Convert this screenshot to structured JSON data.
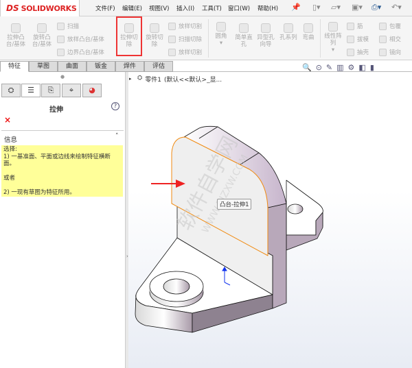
{
  "app": {
    "logo": "SOLIDWORKS",
    "logo_mark": "DS"
  },
  "menu": [
    "文件(F)",
    "编辑(E)",
    "视图(V)",
    "插入(I)",
    "工具(T)",
    "窗口(W)",
    "帮助(H)"
  ],
  "quick_access_icons": [
    "pin-icon",
    "new-icon",
    "open-icon",
    "save-icon",
    "print-icon",
    "undo-icon"
  ],
  "ribbon": {
    "extrude_boss": "拉伸凸\n台/基体",
    "revolve_boss": "旋转凸\n台/基体",
    "sweep": "扫描",
    "loft_boss": "放样凸台/基体",
    "boundary_boss": "边界凸台/基体",
    "extrude_cut": "拉伸切\n除",
    "revolve_cut": "旋转切\n除",
    "loft_cut": "放样切割",
    "sweep_cut": "扫描切除",
    "boundary_cut": "放样切割",
    "fillet": "圆角",
    "simple_hole": "简单直\n孔",
    "hole_wizard": "异型孔\n向导",
    "hole_series": "孔系列",
    "flex": "弯曲",
    "linear_pattern": "线性阵\n列",
    "rib": "筋",
    "draft": "拔模",
    "shell": "抽壳",
    "wrap": "包覆",
    "intersect": "相交",
    "mirror": "镜向"
  },
  "tabs": [
    "特征",
    "草图",
    "曲面",
    "钣金",
    "焊件",
    "评估"
  ],
  "active_tab": "特征",
  "property_manager": {
    "title": "拉伸",
    "help": "?",
    "cancel": "×",
    "section": "信息",
    "message_lines": [
      "选择:",
      "1) 一基准面、平面或边线来绘制特征横断面。",
      "",
      "或者",
      "",
      "2) 一现有草图为特征所用。"
    ],
    "message_bg": "#ffff99"
  },
  "tree": {
    "item": "零件1",
    "config": "(默认<<默认>_显..."
  },
  "viewport": {
    "tooltip": "凸台-拉伸1",
    "watermark": "软件自学网",
    "watermark_url": "WWW.RJZXW.COM",
    "highlight_color": "#ff8800",
    "arrow_color": "#ee2222"
  }
}
